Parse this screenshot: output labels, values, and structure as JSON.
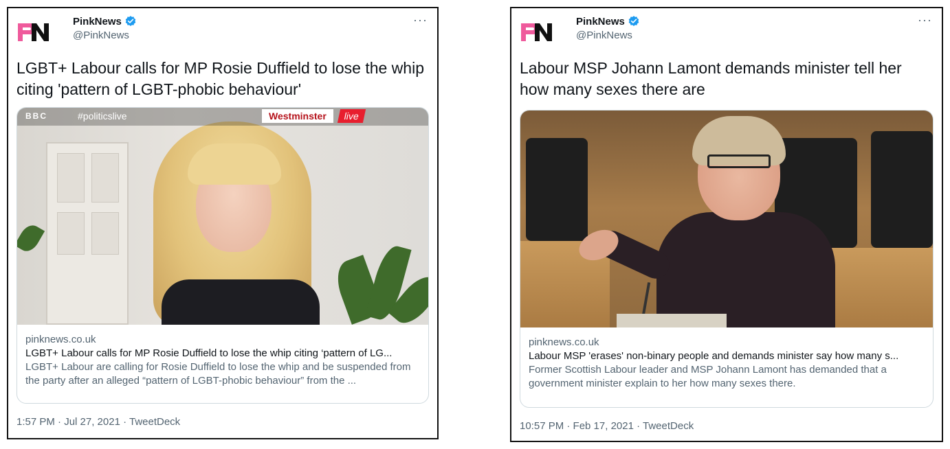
{
  "tweets": [
    {
      "account": {
        "name": "PinkNews",
        "handle": "@PinkNews",
        "logo_text": "PN"
      },
      "more_label": "···",
      "text": "LGBT+ Labour calls for MP Rosie Duffield to lose the whip citing 'pattern of LGBT-phobic behaviour'",
      "media_overlay": {
        "broadcaster": "BBC",
        "hashtag": "#politicslive",
        "location": "Westminster",
        "live": "live"
      },
      "card": {
        "domain": "pinknews.co.uk",
        "title": "LGBT+ Labour calls for MP Rosie Duffield to lose the whip citing ‘pattern of LG...",
        "description": "LGBT+ Labour are calling for Rosie Duffield to lose the whip and be suspended from the party after an alleged “pattern of LGBT-phobic behaviour” from the ..."
      },
      "footer": "1:57 PM · Jul 27, 2021 · TweetDeck"
    },
    {
      "account": {
        "name": "PinkNews",
        "handle": "@PinkNews",
        "logo_text": "PN"
      },
      "more_label": "···",
      "text": "Labour MSP Johann Lamont demands minister tell her how many sexes there are",
      "card": {
        "domain": "pinknews.co.uk",
        "title": "Labour MSP 'erases' non-binary people and demands minister say how many s...",
        "description": "Former Scottish Labour leader and MSP Johann Lamont has demanded that a government minister explain to her how many sexes there."
      },
      "footer": "10:57 PM · Feb 17, 2021 · TweetDeck"
    }
  ],
  "colors": {
    "verified": "#1d9bf0",
    "logo_pink": "#ef5a9c",
    "logo_dark": "#111111",
    "muted_text": "#536471",
    "border": "#cfd9de"
  },
  "icons": {
    "verified": "verified-badge-icon",
    "more": "more-options-icon"
  }
}
